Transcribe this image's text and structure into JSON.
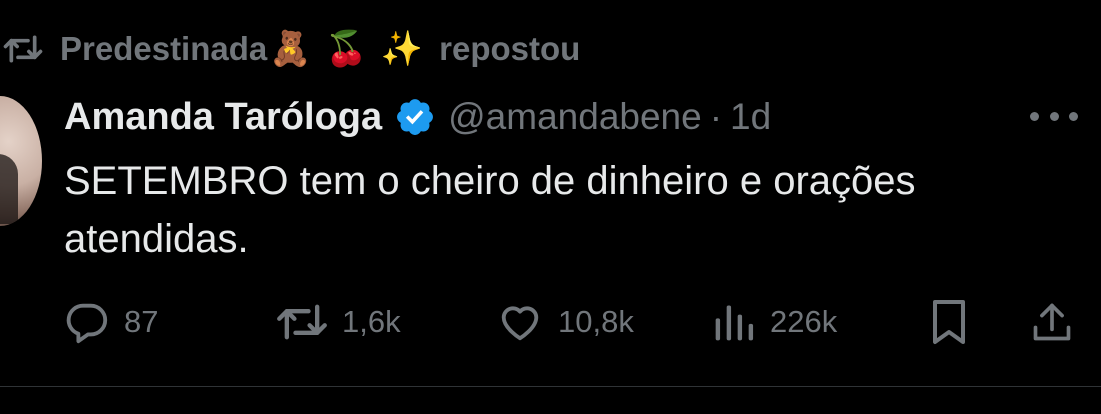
{
  "repost": {
    "icon": "repost-icon",
    "reposter_name": "Predestinada",
    "reposter_emojis": "🧸 🍒 ✨",
    "suffix": "repostou"
  },
  "author": {
    "name": "Amanda Taróloga",
    "verified": true,
    "handle": "@amandabene",
    "separator": "·",
    "time": "1d"
  },
  "tweet": {
    "text": "SETEMBRO tem o cheiro de dinheiro e orações atendidas."
  },
  "actions": {
    "replies": "87",
    "reposts": "1,6k",
    "likes": "10,8k",
    "views": "226k"
  },
  "colors": {
    "background": "#000000",
    "text_primary": "#e7e9ea",
    "text_secondary": "#71767b",
    "verified_blue": "#1d9bf0"
  }
}
